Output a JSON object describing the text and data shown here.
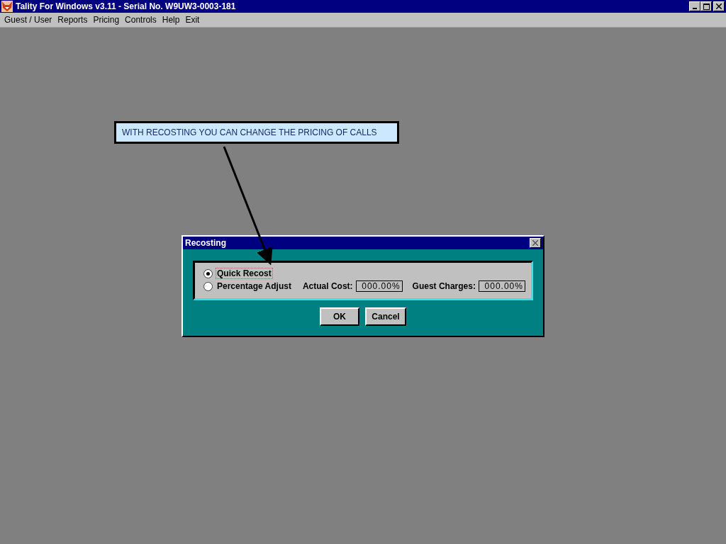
{
  "window": {
    "title": "Tality For Windows v3.11 - Serial No. W9UW3-0003-181"
  },
  "menu": [
    "Guest / User",
    "Reports",
    "Pricing",
    "Controls",
    "Help",
    "Exit"
  ],
  "callout": {
    "text": "WITH RECOSTING YOU CAN CHANGE THE PRICING OF CALLS"
  },
  "dialog": {
    "title": "Recosting",
    "options": [
      {
        "label": "Quick Recost",
        "selected": true
      },
      {
        "label": "Percentage Adjust",
        "selected": false
      }
    ],
    "fields": [
      {
        "label": "Actual Cost:",
        "value": "000.00%"
      },
      {
        "label": "Guest Charges:",
        "value": "000.00%"
      }
    ],
    "buttons": [
      "OK",
      "Cancel"
    ]
  }
}
